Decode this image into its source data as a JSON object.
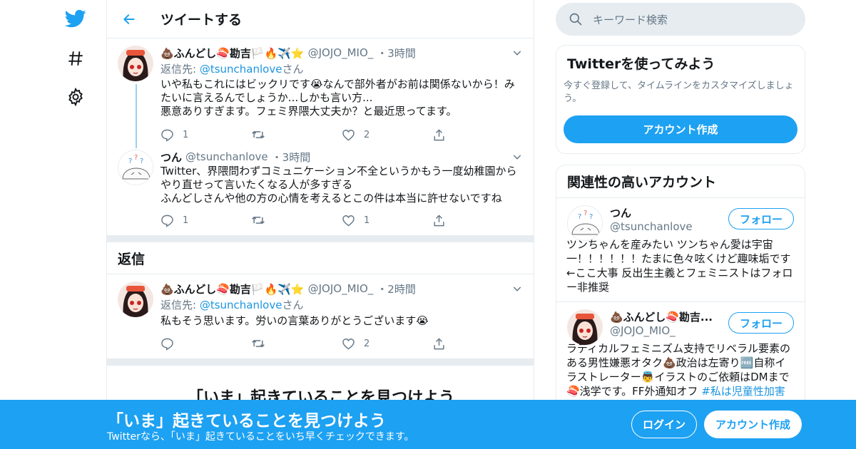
{
  "header": {
    "title": "ツイートする"
  },
  "tweets": [
    {
      "name": "💩ふんどし🍣勘吉🏳️🔥✈️⭐",
      "handle": "@JOJO_MIO_",
      "dot": "・",
      "time": "3時間",
      "reply_label": "返信先: ",
      "reply_mention": "@tsunchanlove",
      "reply_suffix": "さん",
      "text": "いや私もこれにはビックリです😭なんで部外者がお前は関係ないから！みたいに言えるんでしょうか...しかも言い方...\n悪意ありすぎます。フェミ界隈大丈夫か？と最近思ってます。",
      "replies": "1",
      "retweets": "",
      "likes": "2"
    },
    {
      "name": "つん",
      "handle": "@tsunchanlove",
      "dot": "・",
      "time": "3時間",
      "text": "Twitter、界隈問わずコミュニケーション不全というかもう一度幼稚園からやり直せって言いたくなる人が多すぎる\nふんどしさんや他の方の心情を考えるとこの件は本当に許せないですね",
      "replies": "1",
      "retweets": "",
      "likes": "1"
    }
  ],
  "replies_section": {
    "title": "返信"
  },
  "reply_tweet": {
    "name": "💩ふんどし🍣勘吉🏳️🔥✈️⭐",
    "handle": "@JOJO_MIO_",
    "dot": "・",
    "time": "2時間",
    "reply_label": "返信先: ",
    "reply_mention": "@tsunchanlove",
    "reply_suffix": "さん",
    "text": "私もそう思います。労いの言葉ありがとうございます😭",
    "replies": "",
    "retweets": "",
    "likes": "2"
  },
  "discover_heading": "「いま」起きていることを見つけよう",
  "search": {
    "placeholder": "キーワード検索"
  },
  "try_card": {
    "title": "Twitterを使ってみよう",
    "text": "今すぐ登録して、タイムラインをカスタマイズしましょう。",
    "button": "アカウント作成"
  },
  "related": {
    "title": "関連性の高いアカウント",
    "accounts": [
      {
        "name": "つん",
        "handle": "@tsunchanlove",
        "follow": "フォロー",
        "bio": "ツンちゃんを産みたい ツンちゃん愛は宇宙一！！！！！！たまに色々呟くけど趣味垢です←ここ大事 反出生主義とフェミニストはフォロー非推奨"
      },
      {
        "name": "💩ふんどし🍣勘吉...",
        "handle": "@JOJO_MIO_",
        "follow": "フォロー",
        "bio": "ラディカルフェミニズム支持でリベラル要素のある男性嫌悪オタク💩政治は左寄り🆓自称イラストレーター👼イラストのご依頼はDMまで🍣浅学です。FF外通知オフ ",
        "bio_hashtag": "#私は児童性加害を"
      }
    ]
  },
  "bottom_bar": {
    "title": "「いま」起きていることを見つけよう",
    "subtitle": "Twitterなら、「いま」起きていることをいち早くチェックできます。",
    "login": "ログイン",
    "signup": "アカウント作成"
  },
  "colors": {
    "brand": "#1da1f2",
    "border": "#e6ecf0",
    "muted": "#657786",
    "link": "#1b95e0"
  },
  "icons": [
    "twitter-bird-icon",
    "hashtag-icon",
    "gear-icon",
    "back-arrow-icon",
    "chevron-down-icon",
    "reply-icon",
    "retweet-icon",
    "like-icon",
    "share-icon",
    "search-icon"
  ]
}
